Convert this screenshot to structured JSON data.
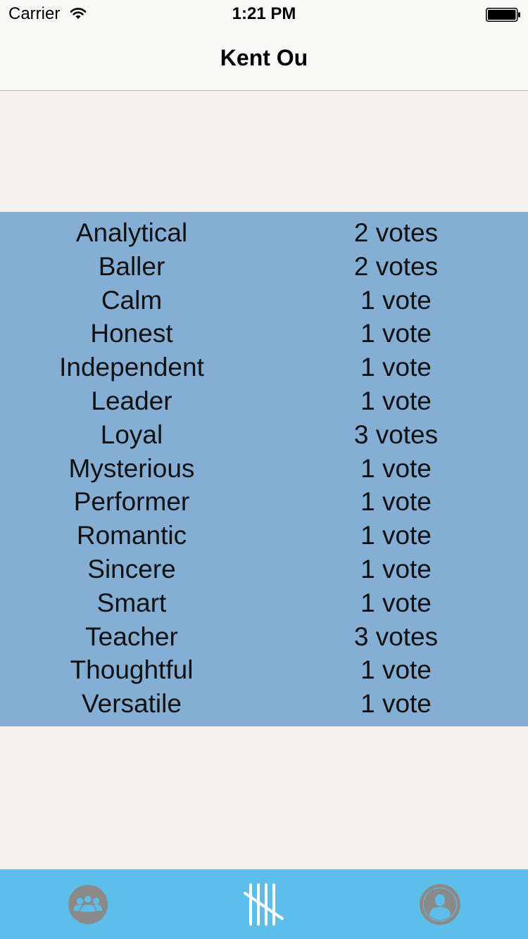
{
  "status_bar": {
    "carrier": "Carrier",
    "time": "1:21 PM",
    "wifi_icon": "wifi-icon",
    "battery_icon": "battery-icon"
  },
  "nav": {
    "title": "Kent Ou"
  },
  "votes": [
    {
      "trait": "Analytical",
      "count": "2 votes"
    },
    {
      "trait": "Baller",
      "count": "2 votes"
    },
    {
      "trait": "Calm",
      "count": "1 vote"
    },
    {
      "trait": "Honest",
      "count": "1 vote"
    },
    {
      "trait": "Independent",
      "count": "1 vote"
    },
    {
      "trait": "Leader",
      "count": "1 vote"
    },
    {
      "trait": "Loyal",
      "count": "3 votes"
    },
    {
      "trait": "Mysterious",
      "count": "1 vote"
    },
    {
      "trait": "Performer",
      "count": "1 vote"
    },
    {
      "trait": "Romantic",
      "count": "1 vote"
    },
    {
      "trait": "Sincere",
      "count": "1 vote"
    },
    {
      "trait": "Smart",
      "count": "1 vote"
    },
    {
      "trait": "Teacher",
      "count": "3 votes"
    },
    {
      "trait": "Thoughtful",
      "count": "1 vote"
    },
    {
      "trait": "Versatile",
      "count": "1 vote"
    }
  ],
  "tab_bar": {
    "tabs": [
      {
        "icon": "group-icon",
        "selected": false
      },
      {
        "icon": "tally-icon",
        "selected": true
      },
      {
        "icon": "profile-icon",
        "selected": false
      }
    ]
  },
  "colors": {
    "panel": "#85aed4",
    "tab_bar": "#5dbeea",
    "background": "#f3f2ed",
    "tab_icon_inactive": "#8a8a8a",
    "tab_icon_active": "#ffffff"
  }
}
